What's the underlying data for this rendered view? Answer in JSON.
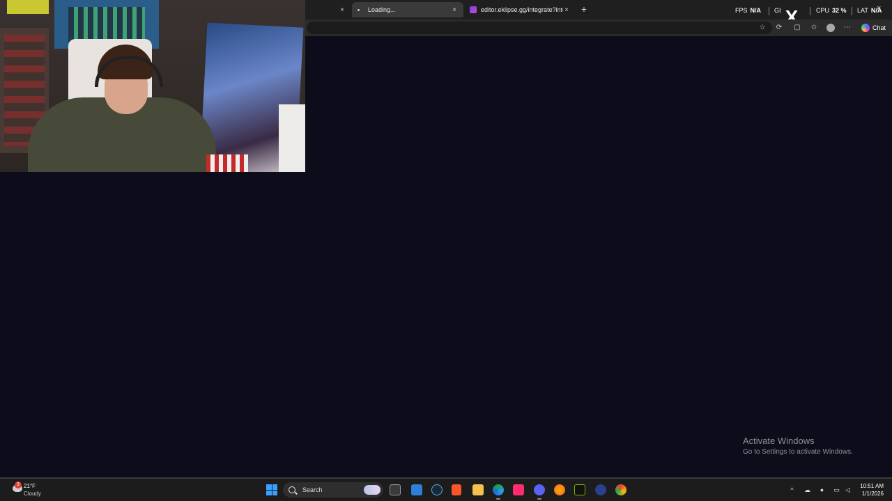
{
  "browser": {
    "tabs": [
      {
        "title": "",
        "active": false
      },
      {
        "title": "Loading...",
        "active": true
      },
      {
        "title": "editor.eklipse.gg/integrate?integra",
        "active": false
      }
    ],
    "new_tab_label": "+",
    "close_label": "×",
    "chat_label": "Chat"
  },
  "overlay": {
    "fps_label": "FPS",
    "fps_value": "N/A",
    "gpu_label": "GI",
    "cpu_label": "CPU",
    "cpu_value": "32 %",
    "lat_label": "LAT",
    "lat_value": "N/A",
    "x_logo": "X"
  },
  "watermark": {
    "title": "Activate Windows",
    "subtitle": "Go to Settings to activate Windows."
  },
  "taskbar": {
    "weather": {
      "badge": "3",
      "temp": "21°F",
      "condition": "Cloudy"
    },
    "search_placeholder": "Search",
    "clock": {
      "time": "10:51 AM",
      "date": "1/1/2026"
    },
    "apps": [
      "file-explorer",
      "notepad",
      "steam",
      "brave",
      "folder",
      "edge",
      "tiktok",
      "discord",
      "firefox",
      "nvidia",
      "app",
      "chrome"
    ]
  },
  "colors": {
    "page_bg": "#0d0c1a",
    "taskbar_bg": "#1c1c1c",
    "tab_bar_bg": "#1f1f1f",
    "accent_windows": "#3aa0ff"
  }
}
